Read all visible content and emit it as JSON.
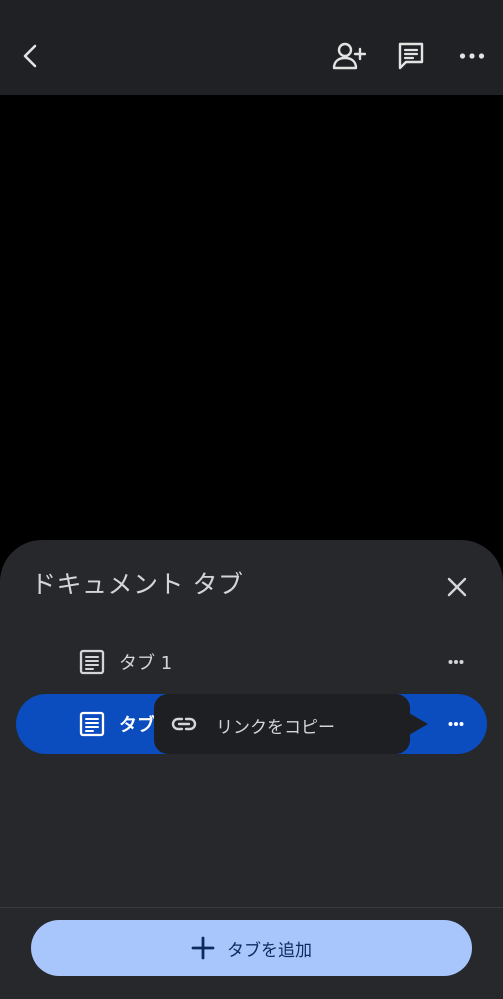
{
  "topbar": {
    "back_icon": "chevron-left-icon",
    "share_icon": "person-add-icon",
    "comment_icon": "comment-icon",
    "more_icon": "more-horizontal-icon"
  },
  "sheet": {
    "title": "ドキュメント タブ",
    "close_icon": "close-icon",
    "tabs": [
      {
        "label": "タブ 1",
        "icon": "document-icon",
        "selected": false
      },
      {
        "label": "タブ",
        "icon": "document-icon",
        "selected": true
      }
    ],
    "context_menu": {
      "icon": "link-icon",
      "label": "リンクをコピー"
    },
    "add_button": {
      "icon": "plus-icon",
      "label": "タブを追加"
    }
  },
  "colors": {
    "background": "#000000",
    "surface": "#27282b",
    "selected_row": "#0b4cbf",
    "add_button": "#a8c6fb",
    "add_button_text": "#0d2a5c"
  }
}
